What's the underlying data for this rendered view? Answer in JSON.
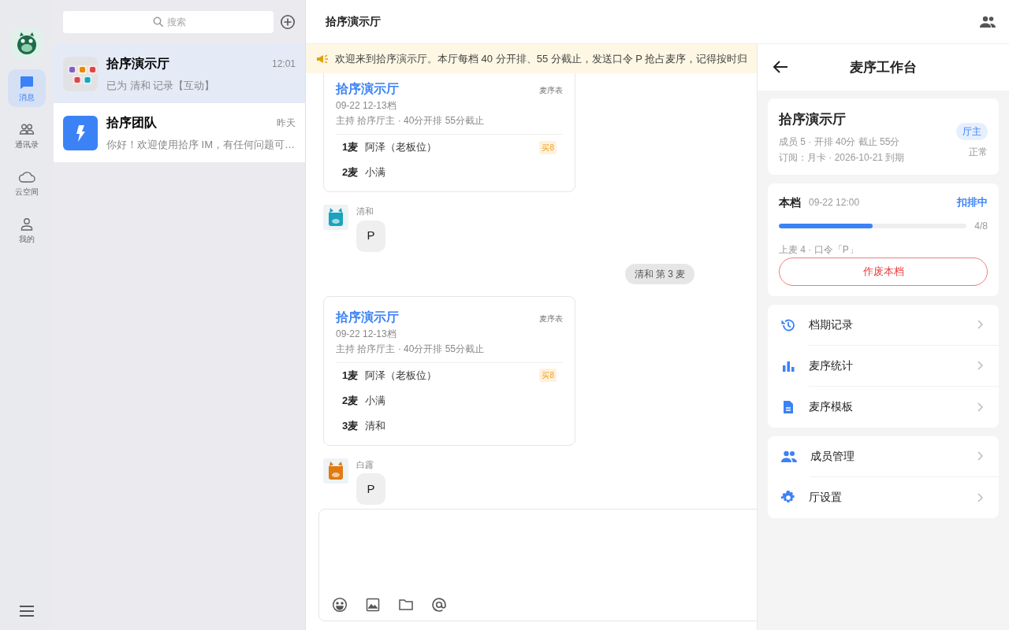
{
  "rail": {
    "items": [
      {
        "label": "消息",
        "selected": true
      },
      {
        "label": "通讯录",
        "selected": false
      },
      {
        "label": "云空间",
        "selected": false
      },
      {
        "label": "我的",
        "selected": false
      }
    ]
  },
  "chat_list": {
    "search": {
      "placeholder": "搜索"
    },
    "conversations": [
      {
        "kind": "group",
        "name": "拾序演示厅",
        "time": "12:01",
        "preview": "已为 清和 记录【互动】",
        "selected": true
      },
      {
        "kind": "bolt",
        "name": "拾序团队",
        "time": "昨天",
        "preview": "你好！欢迎使用拾序 IM，有任何问题可…",
        "selected": false
      }
    ]
  },
  "chat": {
    "title": "拾序演示厅",
    "notice": "欢迎来到拾序演示厅。本厅每档 40 分开排、55 分截止，发送口令 P 抢占麦序，记得按时归",
    "messages": [
      {
        "kind": "card",
        "title": "拾序演示厅",
        "tag": "麦序表",
        "date": "09-22 12-13档",
        "meta": "主持 拾序厅主 · 40分开排 55分截止",
        "rows": [
          {
            "pos": "1麦",
            "name": "阿泽（老板位）",
            "badge": "买8"
          },
          {
            "pos": "2麦",
            "name": "小满"
          }
        ]
      },
      {
        "kind": "text",
        "sender": "清和",
        "color": "#1aa3bd",
        "text": "P"
      },
      {
        "kind": "system",
        "text": "清和 第 3 麦"
      },
      {
        "kind": "card",
        "title": "拾序演示厅",
        "tag": "麦序表",
        "date": "09-22 12-13档",
        "meta": "主持 拾序厅主 · 40分开排 55分截止",
        "rows": [
          {
            "pos": "1麦",
            "name": "阿泽（老板位）",
            "badge": "买8"
          },
          {
            "pos": "2麦",
            "name": "小满"
          },
          {
            "pos": "3麦",
            "name": "清和"
          }
        ]
      },
      {
        "kind": "text",
        "sender": "白露",
        "color": "#e07b12",
        "text": "P"
      }
    ]
  },
  "panel": {
    "title": "麦序工作台",
    "hall": {
      "name": "拾序演示厅",
      "role": "厅主",
      "status": "正常",
      "lines": [
        "成员 5 · 开排 40分 截止 55分",
        "订阅：月卡 · 2026-10-21 到期"
      ]
    },
    "current": {
      "label": "本档",
      "date": "09-22 12:00",
      "status": "扣排中",
      "level": 0.5,
      "count": "4/8",
      "info": "上麦 4 · 口令「P」",
      "action": "作废本档"
    },
    "menu_groups": [
      [
        "档期记录",
        "麦序统计",
        "麦序模板"
      ],
      [
        "成员管理",
        "厅设置"
      ]
    ]
  }
}
